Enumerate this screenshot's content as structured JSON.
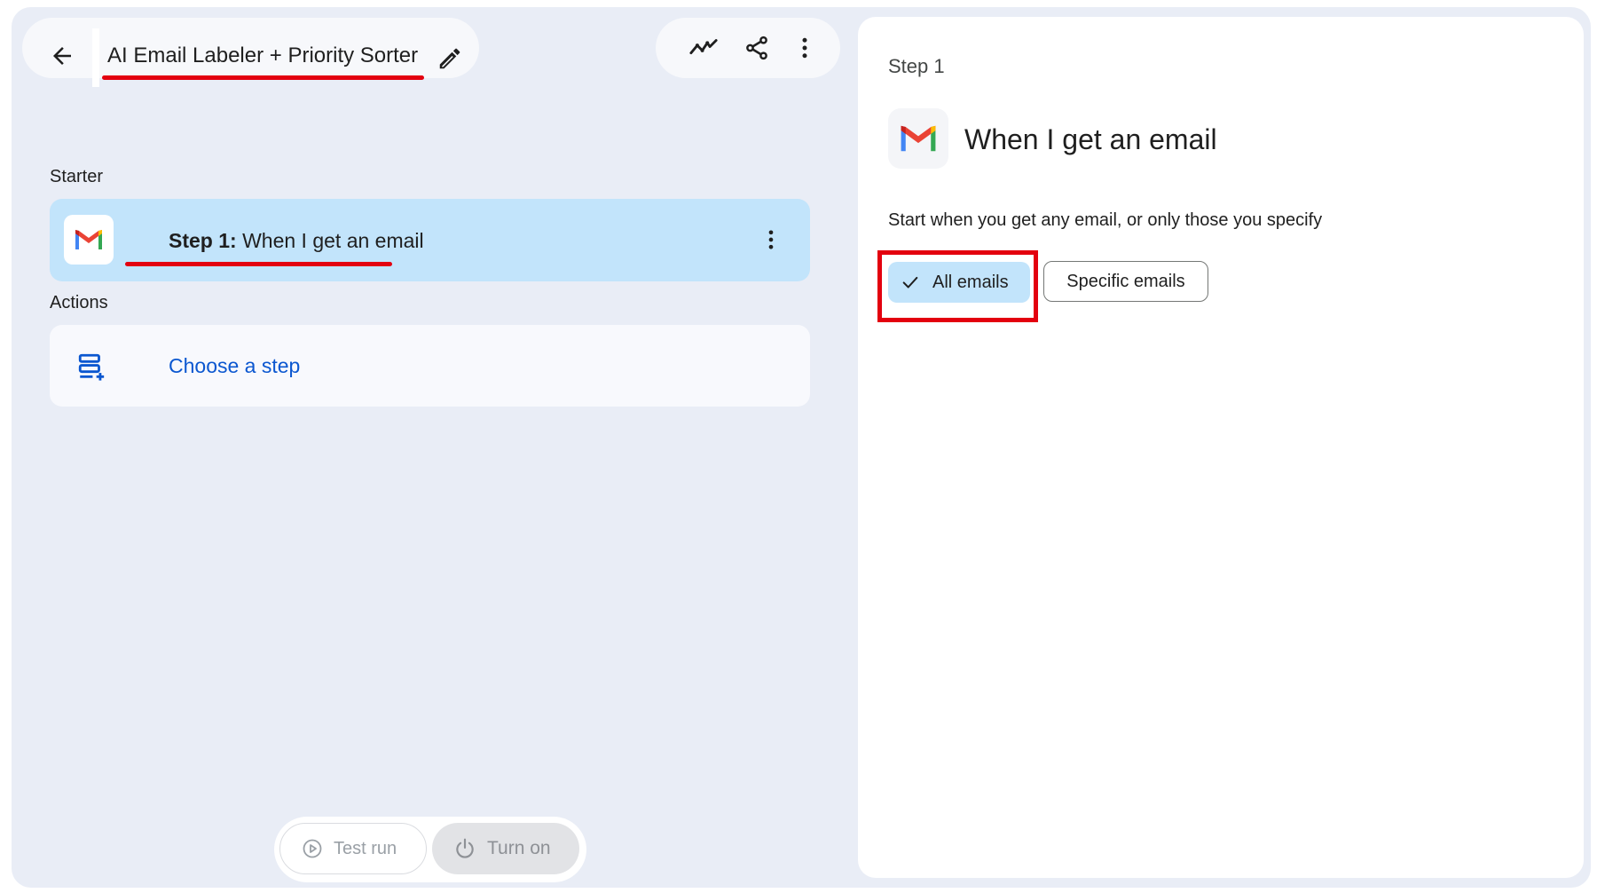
{
  "header": {
    "title": "AI Email Labeler + Priority Sorter"
  },
  "sections": {
    "starter_label": "Starter",
    "actions_label": "Actions"
  },
  "starter": {
    "step_prefix": "Step 1:",
    "step_name": "When I get an email"
  },
  "actions": {
    "choose_label": "Choose a step"
  },
  "bottom_bar": {
    "test_run_label": "Test run",
    "turn_on_label": "Turn on"
  },
  "panel": {
    "step_label": "Step 1",
    "title": "When I get an email",
    "description": "Start when you get any email, or only those you specify",
    "options": {
      "all": "All emails",
      "specific": "Specific emails"
    },
    "selected_option": "All emails"
  },
  "icons": {
    "back": "arrow-back-icon",
    "edit": "pencil-icon",
    "activity": "activity-chart-icon",
    "share": "share-icon",
    "more": "more-vert-icon",
    "gmail": "gmail-logo-icon",
    "add_step": "add-step-icon",
    "play": "play-circle-icon",
    "power": "power-icon",
    "check": "check-icon"
  },
  "colors": {
    "annotation_red": "#e3000f",
    "selected_blue": "#c2e4fb",
    "link_blue": "#0b57d0",
    "canvas": "#e9edf6"
  }
}
